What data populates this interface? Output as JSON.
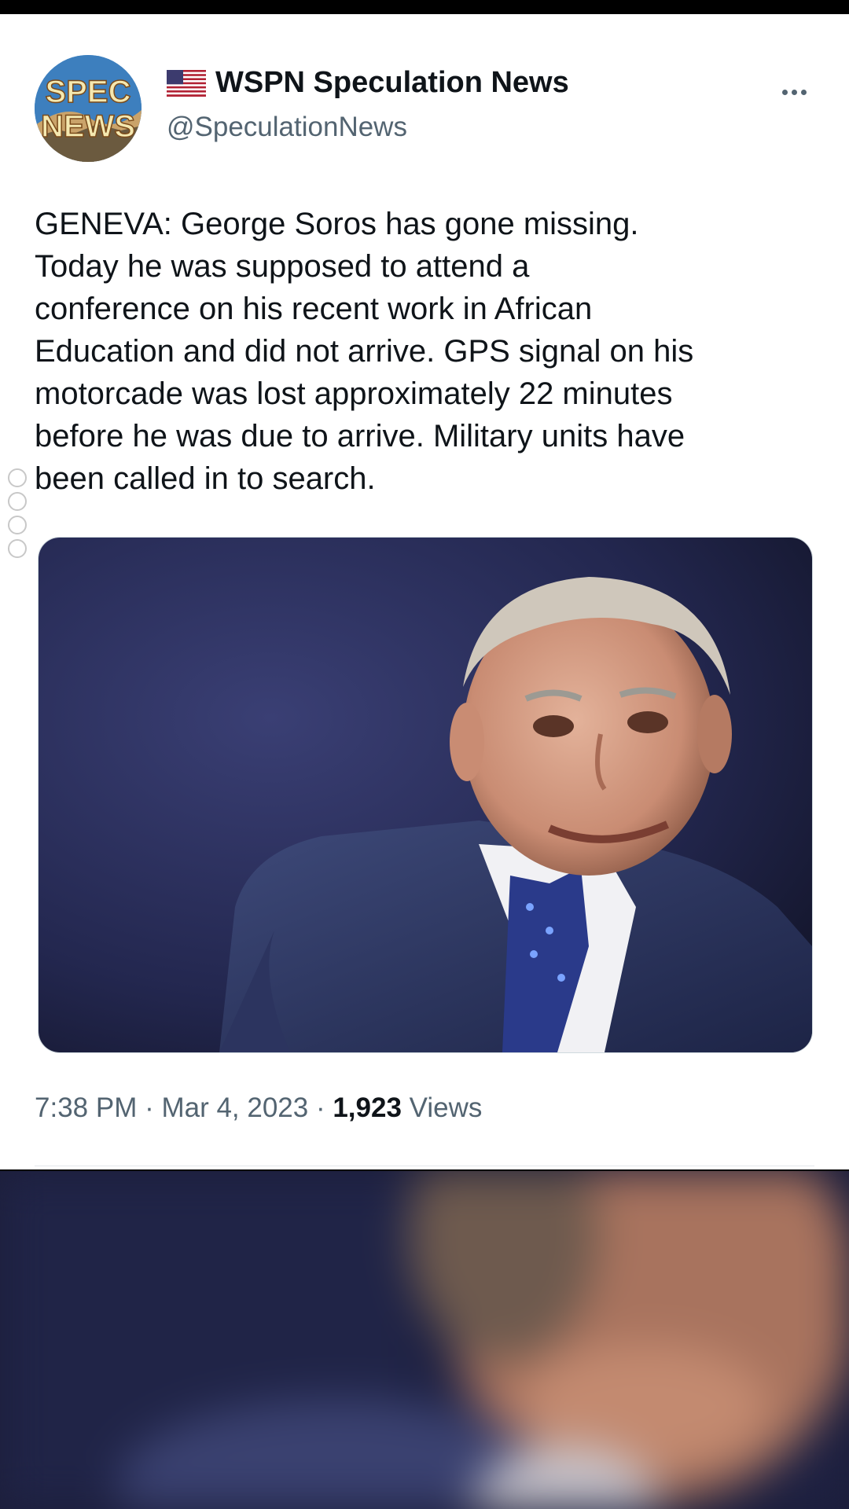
{
  "tweet": {
    "avatar_text": "SPEC NEWS",
    "display_name": "WSPN Speculation News",
    "handle": "@SpeculationNews",
    "flag_icon": "us-flag-icon",
    "more_icon": "more-dots-icon",
    "text_lines": [
      "GENEVA: George Soros has gone missing.",
      "Today he was supposed to attend a",
      "conference on his recent work in African",
      "Education and did not arrive. GPS signal on his",
      "motorcade was lost approximately 22 minutes",
      "before he was due to arrive. Military units have",
      "been called in to search."
    ],
    "timestamp": "7:38 PM · Mar 4, 2023 · ",
    "views_count": "1,923",
    "views_label": " Views"
  },
  "colors": {
    "text_primary": "#0f1419",
    "text_secondary": "#536471",
    "card_background": "#ffffff",
    "photo_background": "#242852"
  }
}
